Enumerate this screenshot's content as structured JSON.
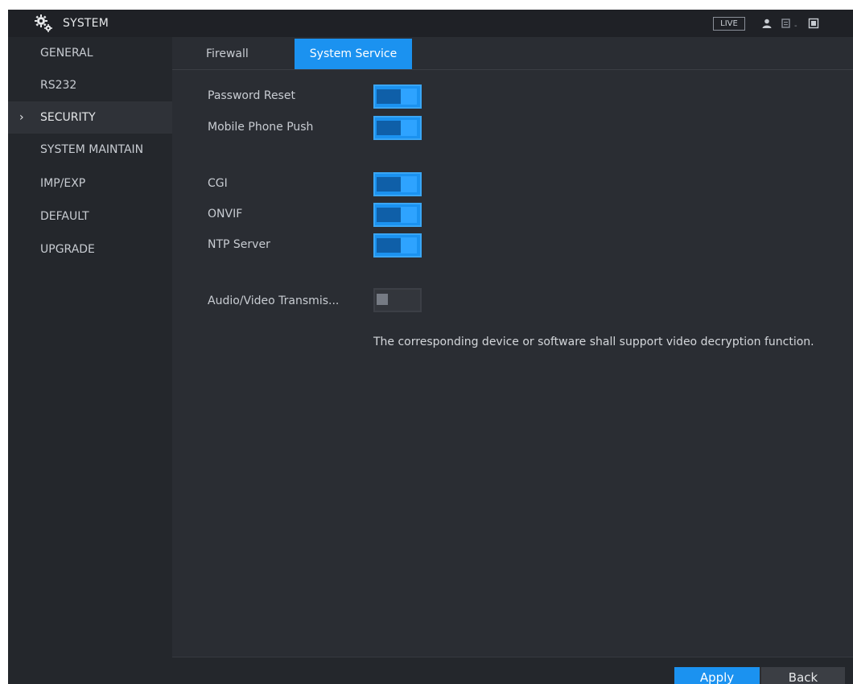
{
  "window": {
    "title": "SYSTEM",
    "live_label": "LIVE",
    "separator": "-"
  },
  "sidebar": {
    "items": [
      {
        "label": "GENERAL"
      },
      {
        "label": "RS232"
      },
      {
        "label": "SECURITY",
        "active": true,
        "marker": "›"
      },
      {
        "label": "SYSTEM MAINTAIN"
      },
      {
        "label": "IMP/EXP"
      },
      {
        "label": "DEFAULT"
      },
      {
        "label": "UPGRADE"
      }
    ]
  },
  "tabs": [
    {
      "label": "Firewall",
      "active": false
    },
    {
      "label": "System Service",
      "active": true
    }
  ],
  "settings": [
    {
      "label": "Password Reset",
      "enabled": true
    },
    {
      "label": "Mobile Phone Push",
      "enabled": true
    },
    {
      "label": "CGI",
      "enabled": true
    },
    {
      "label": "ONVIF",
      "enabled": true
    },
    {
      "label": "NTP Server",
      "enabled": true
    },
    {
      "label": "Audio/Video Transmis...",
      "enabled": false
    }
  ],
  "note": "The corresponding device or software shall support video decryption function.",
  "footer": {
    "apply_label": "Apply",
    "back_label": "Back"
  },
  "colors": {
    "accent": "#1b92f0",
    "background": "#2a2d33",
    "sidebar": "#24272c"
  },
  "icons": {
    "title": "gears-icon",
    "user": "user-icon",
    "window": "window-icon",
    "exit": "exit-icon"
  }
}
